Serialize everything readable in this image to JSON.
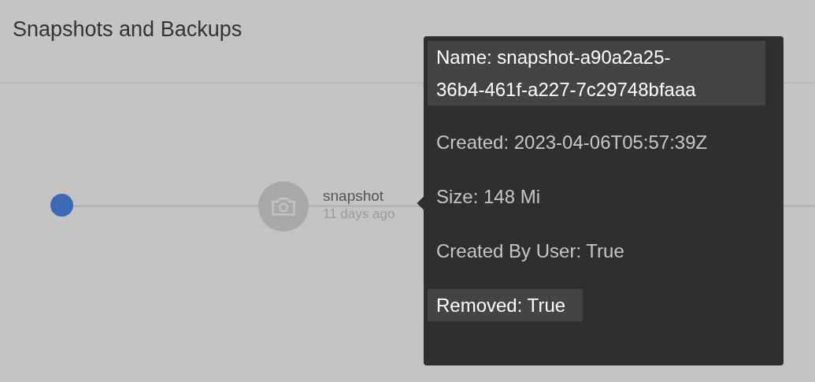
{
  "header": {
    "title": "Snapshots and Backups"
  },
  "timeline": {
    "snapshots": [
      {
        "label": "snapshot",
        "age": "11 days ago"
      }
    ]
  },
  "tooltip": {
    "rows": [
      {
        "text": "Name: snapshot-a90a2a25-36b4-461f-a227-7c29748bfaaa",
        "highlighted": true
      },
      {
        "text": "Created: 2023-04-06T05:57:39Z",
        "highlighted": false
      },
      {
        "text": "Size: 148 Mi",
        "highlighted": false
      },
      {
        "text": "Created By User: True",
        "highlighted": false
      },
      {
        "text": "Removed: True",
        "highlighted": true
      }
    ]
  }
}
